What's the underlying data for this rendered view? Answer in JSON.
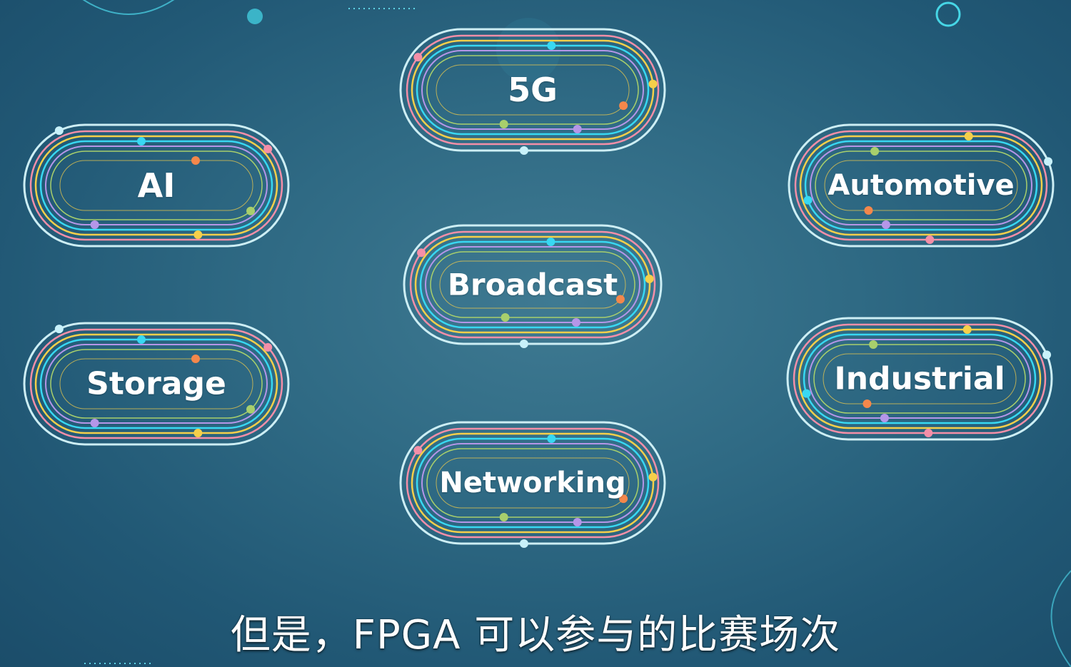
{
  "segments": [
    {
      "id": "5g",
      "label": "5G"
    },
    {
      "id": "ai",
      "label": "AI"
    },
    {
      "id": "automotive",
      "label": "Automotive"
    },
    {
      "id": "broadcast",
      "label": "Broadcast"
    },
    {
      "id": "storage",
      "label": "Storage"
    },
    {
      "id": "industrial",
      "label": "Industrial"
    },
    {
      "id": "networking",
      "label": "Networking"
    }
  ],
  "subtitle": "但是，FPGA 可以参与的比赛场次",
  "colors": {
    "ring_outer": "#cdeef4",
    "ring_pink": "#f48fa8",
    "ring_yellow": "#f5cf4a",
    "ring_cyan": "#38d8f2",
    "ring_purple": "#b596e8",
    "ring_green": "#a8cf6c",
    "dot_orange": "#f4874b",
    "dot_light": "#c8f1fa"
  }
}
